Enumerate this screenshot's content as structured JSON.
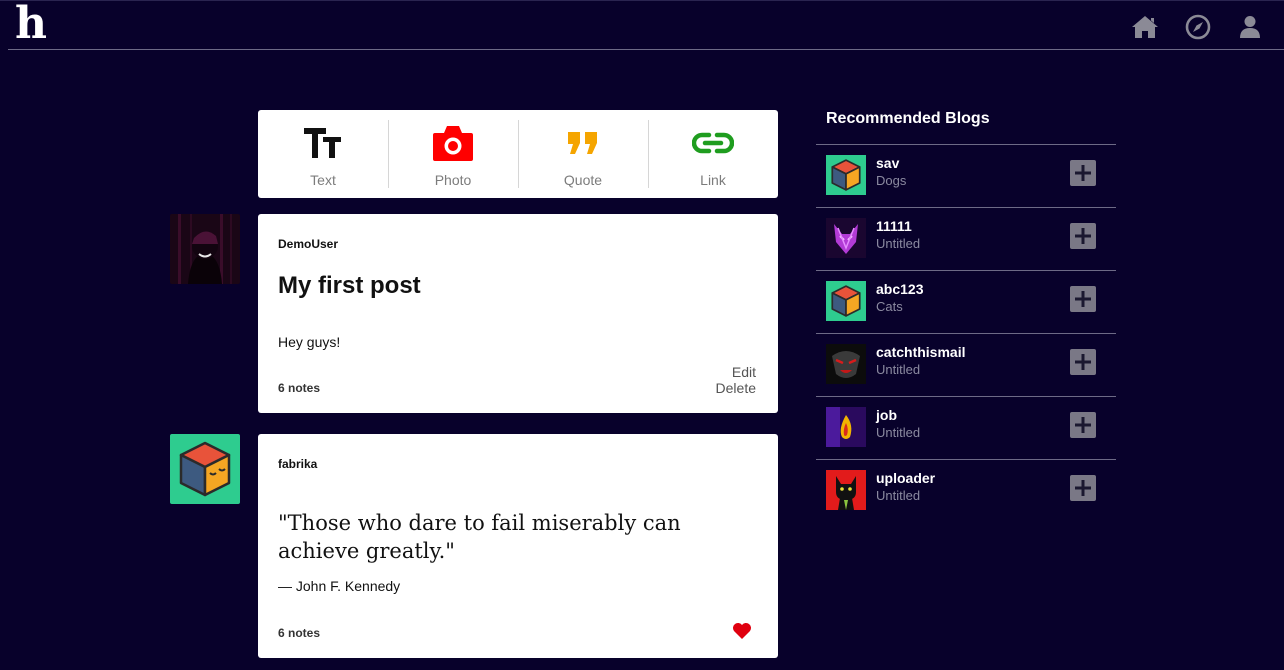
{
  "app": {
    "logo": "h"
  },
  "nav": {
    "icons": [
      "home-icon",
      "compass-icon",
      "user-icon"
    ],
    "icon_color": "#8b8a96"
  },
  "composer": {
    "buttons": [
      {
        "label": "Text",
        "icon": "text-icon",
        "color": "#111111"
      },
      {
        "label": "Photo",
        "icon": "camera-icon",
        "color": "#ff0000"
      },
      {
        "label": "Quote",
        "icon": "quote-icon",
        "color": "#f5a500"
      },
      {
        "label": "Link",
        "icon": "link-icon",
        "color": "#1f9d1f"
      }
    ]
  },
  "posts": [
    {
      "user": "DemoUser",
      "title": "My first post",
      "body": "Hey guys!",
      "notes": "6 notes",
      "edit_label": "Edit",
      "delete_label": "Delete"
    },
    {
      "user": "fabrika",
      "quote": "\"Those who dare to fail miserably can achieve greatly.\"",
      "source": "— John F. Kennedy",
      "notes": "6 notes",
      "liked": true
    }
  ],
  "recommended": {
    "title": "Recommended Blogs",
    "blogs": [
      {
        "name": "sav",
        "subtitle": "Dogs"
      },
      {
        "name": "11111",
        "subtitle": "Untitled"
      },
      {
        "name": "abc123",
        "subtitle": "Cats"
      },
      {
        "name": "catchthismail",
        "subtitle": "Untitled"
      },
      {
        "name": "job",
        "subtitle": "Untitled"
      },
      {
        "name": "uploader",
        "subtitle": "Untitled"
      }
    ]
  },
  "colors": {
    "background": "#08012b",
    "card": "#ffffff",
    "accent_red": "#ff0000",
    "heart": "#e0000f"
  }
}
